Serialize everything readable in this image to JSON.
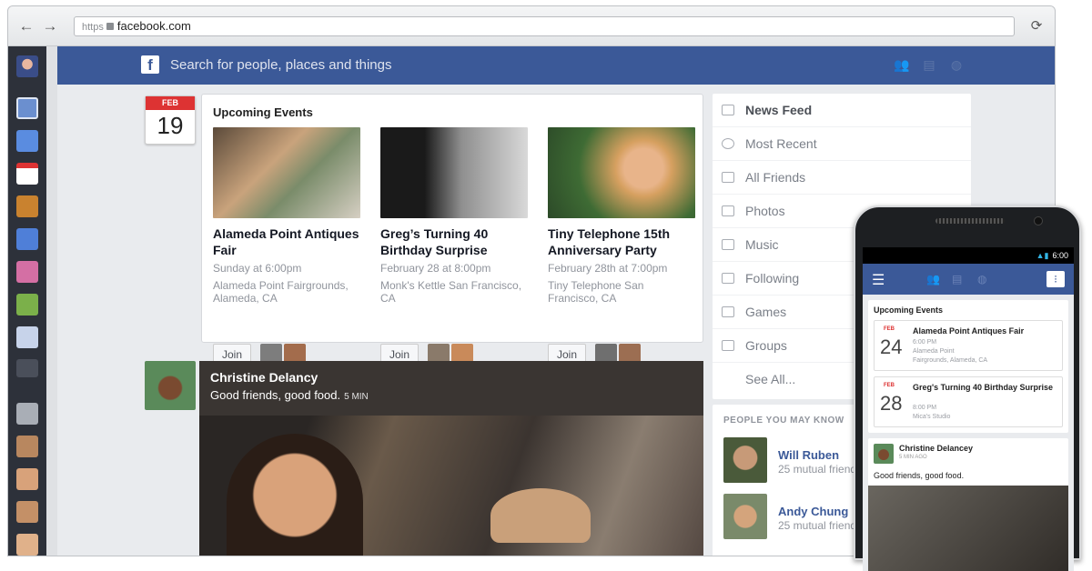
{
  "browser": {
    "back": "←",
    "forward": "→",
    "url_protocol": "https",
    "url_host": "facebook.com",
    "reload": "⟳"
  },
  "header": {
    "logo": "f",
    "search_placeholder": "Search for people, places and things",
    "brand_color": "#3b5998"
  },
  "date_badge": {
    "month": "FEB",
    "day": "19"
  },
  "upcoming_events": {
    "title": "Upcoming Events",
    "join_label": "Join",
    "events": [
      {
        "name": "Alameda Point Antiques Fair",
        "when": "Sunday at 6:00pm",
        "where": "Alameda Point Fairgrounds, Alameda, CA"
      },
      {
        "name": "Greg’s Turning 40 Birthday Surprise",
        "when": "February 28 at 8:00pm",
        "where": "Monk's Kettle San Francisco, CA"
      },
      {
        "name": "Tiny Telephone 15th Anniversary Party",
        "when": "February 28th at 7:00pm",
        "where": "Tiny Telephone San Francisco, CA"
      }
    ]
  },
  "post": {
    "author": "Christine Delancy",
    "text": "Good friends, good food.",
    "time": "5 MIN"
  },
  "right_nav": {
    "items": [
      {
        "label": "News Feed"
      },
      {
        "label": "Most Recent"
      },
      {
        "label": "All Friends"
      },
      {
        "label": "Photos"
      },
      {
        "label": "Music"
      },
      {
        "label": "Following"
      },
      {
        "label": "Games"
      },
      {
        "label": "Groups"
      },
      {
        "label": "See All..."
      }
    ]
  },
  "people_you_may_know": {
    "title": "PEOPLE YOU MAY KNOW",
    "people": [
      {
        "name": "Will Ruben",
        "mutual": "25 mutual friends"
      },
      {
        "name": "Andy Chung",
        "mutual": "25 mutual friends"
      }
    ]
  },
  "phone": {
    "time": "6:00",
    "events_title": "Upcoming Events",
    "events": [
      {
        "month": "FEB",
        "day": "24",
        "name": "Alameda Point Antiques Fair",
        "l1": "6:00 PM",
        "l2": "Alameda Point",
        "l3": "Fairgrounds, Alameda, CA"
      },
      {
        "month": "FEB",
        "day": "28",
        "name": "Greg's Turning 40 Birthday Surprise",
        "l1": "8:00 PM",
        "l2": "Mica's Studio",
        "l3": ""
      }
    ],
    "post": {
      "author": "Christine Delancey",
      "time": "5 MIN AGO",
      "text": "Good friends, good food."
    }
  }
}
